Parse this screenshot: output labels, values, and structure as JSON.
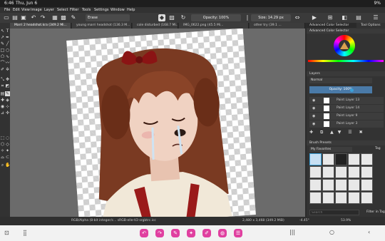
{
  "status": {
    "time": "6:46",
    "date": "Thu, Jun 6",
    "battery": "9%"
  },
  "menu": [
    "File",
    "Edit",
    "View",
    "Image",
    "Layer",
    "Select",
    "Filter",
    "Tools",
    "Settings",
    "Window",
    "Help"
  ],
  "toolbar": {
    "brush_name": "Erase",
    "opacity": "Opacity: 100%",
    "size": "Size: 14.29 px"
  },
  "tabs": [
    "Marri 2 headshot.kra (349.2 Mi...",
    "young marri headshot (136.3 M...",
    "cole disturbed (168.7 Mi...",
    "IMG_0622.png (45.5 Mi...",
    "other try (39.1 ..."
  ],
  "dock": {
    "color_selector_tab": "Advanced Color Selector",
    "tool_options_tab": "Tool Options",
    "color_selector_title": "Advanced Color Selector",
    "layers_title": "Layers",
    "blend_mode": "Normal",
    "opacity_label": "Opacity: 100%",
    "layers": [
      "Paint Layer 13",
      "Paint Layer 14",
      "Paint Layer 9",
      "Paint Layer 3"
    ],
    "brush_presets_title": "Brush Presets",
    "brush_tag": "My Favorites",
    "tag_label": "Tag",
    "search_placeholder": "Search",
    "filter_label": "Filter in Tag"
  },
  "statusbar": {
    "color_info": "RGB/Alpha (8-bit integer/c...  sRGB-elle-V2-srgbtrc.icc",
    "dims": "2,480 x 3,468 (349.2 MiB)",
    "rotation": "-4.45°",
    "zoom": "53.9%"
  },
  "colors": {
    "accent": "#3aa0d8",
    "nav_icon": "#e040a0",
    "canvas_bg": "#6b6b6b"
  }
}
